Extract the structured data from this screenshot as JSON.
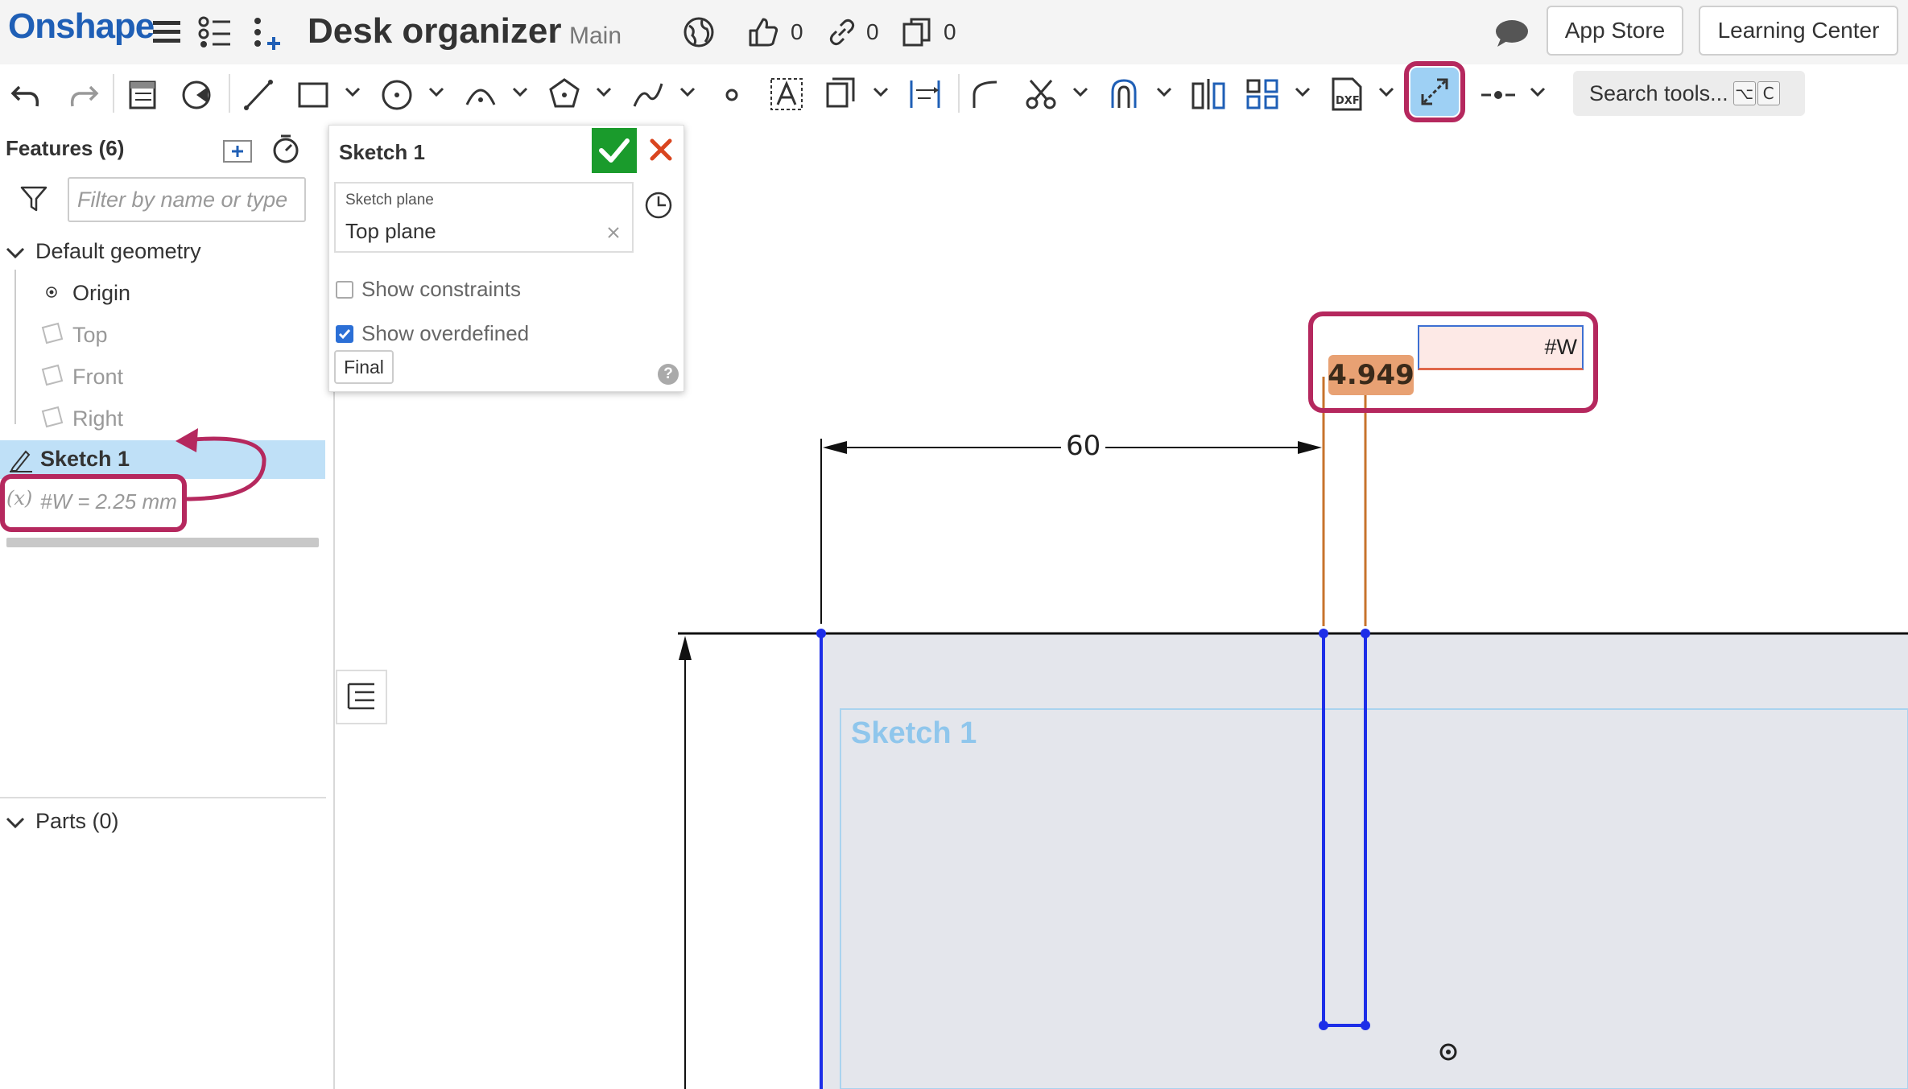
{
  "header": {
    "logo": "Onshape",
    "doc_title": "Desk organizer",
    "branch": "Main",
    "likes": "0",
    "links": "0",
    "copies": "0",
    "app_store": "App Store",
    "learning_center": "Learning Center"
  },
  "toolbar": {
    "search_label": "Search tools...",
    "shortcut_keys": [
      "⌥",
      "C"
    ]
  },
  "features": {
    "title": "Features (6)",
    "filter_placeholder": "Filter by name or type",
    "default_geometry": "Default geometry",
    "items": [
      "Origin",
      "Top",
      "Front",
      "Right"
    ],
    "sketch": "Sketch 1",
    "variable": "#W = 2.25 mm",
    "parts": "Parts (0)"
  },
  "dialog": {
    "title": "Sketch 1",
    "plane_label": "Sketch plane",
    "plane_value": "Top plane",
    "show_constraints": "Show constraints",
    "show_overdefined": "Show overdefined",
    "final": "Final"
  },
  "canvas": {
    "dim_input_value": "#W",
    "dim_value_tag": "4.949",
    "dim_60": "60",
    "sketch_watermark": "Sketch 1"
  },
  "colors": {
    "accent": "#1f5fb6",
    "annotation": "#b5285e",
    "sketch_line": "#1d2ee8",
    "dimension_line": "#c7732c",
    "ok_green": "#1a9b2c"
  }
}
